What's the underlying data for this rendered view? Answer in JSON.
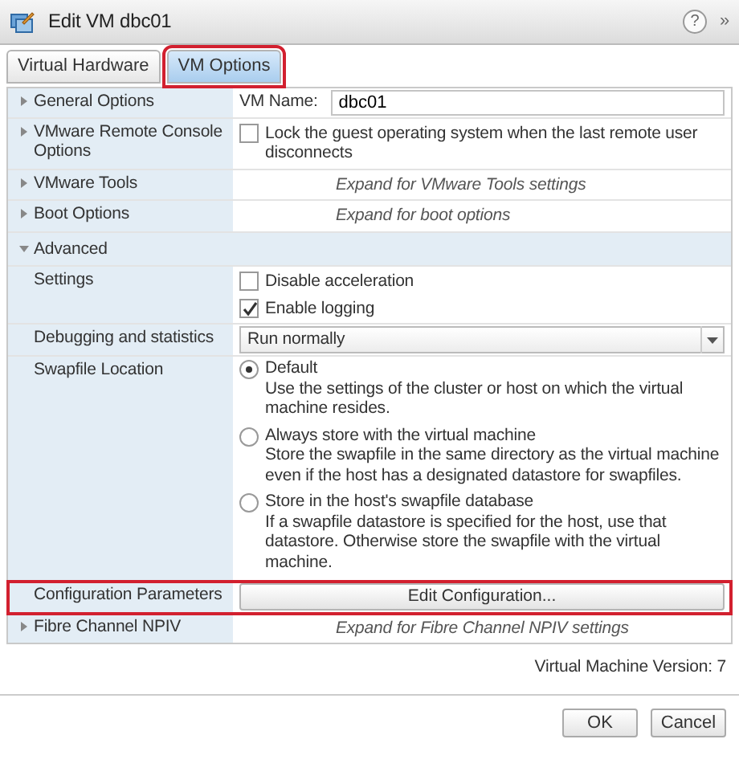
{
  "window": {
    "title": "Edit VM dbc01",
    "help": "?",
    "expand": "»"
  },
  "tabs": [
    {
      "label": "Virtual Hardware",
      "selected": false,
      "highlighted": false
    },
    {
      "label": "VM Options",
      "selected": true,
      "highlighted": true
    }
  ],
  "sections": [
    {
      "kind": "field",
      "label": "General Options",
      "expanded": false,
      "field_label": "VM Name:",
      "value": "dbc01"
    },
    {
      "kind": "checkbox",
      "label": "VMware Remote Console Options",
      "expanded": false,
      "options": [
        {
          "label": "Lock the guest operating system when the last remote user disconnects",
          "checked": false
        }
      ]
    },
    {
      "kind": "hint",
      "label": "VMware Tools",
      "expanded": false,
      "hint": "Expand for VMware Tools settings"
    },
    {
      "kind": "hint",
      "label": "Boot Options",
      "expanded": false,
      "hint": "Expand for boot options"
    },
    {
      "kind": "group",
      "label": "Advanced",
      "expanded": true,
      "children": [
        {
          "kind": "checkbox",
          "label": "Settings",
          "options": [
            {
              "label": "Disable acceleration",
              "checked": false
            },
            {
              "label": "Enable logging",
              "checked": true
            }
          ]
        },
        {
          "kind": "select",
          "label": "Debugging and statistics",
          "value": "Run normally"
        },
        {
          "kind": "radio",
          "label": "Swapfile Location",
          "options": [
            {
              "label": "Default",
              "description": "Use the settings of the cluster or host on which the virtual machine resides.",
              "selected": true
            },
            {
              "label": "Always store with the virtual machine",
              "description": "Store the swapfile in the same directory as the virtual machine even if the host has a designated datastore for swapfiles.",
              "selected": false
            },
            {
              "label": "Store in the host's swapfile database",
              "description": "If a swapfile datastore is specified for the host, use that datastore. Otherwise store the swapfile with the virtual machine.",
              "selected": false
            }
          ]
        },
        {
          "kind": "button",
          "label": "Configuration Parameters",
          "button": "Edit Configuration...",
          "highlighted": true
        }
      ]
    },
    {
      "kind": "hint",
      "label": "Fibre Channel NPIV",
      "expanded": false,
      "hint": "Expand for Fibre Channel NPIV settings"
    }
  ],
  "version": "Virtual Machine Version: 7",
  "buttons": [
    "OK",
    "Cancel"
  ]
}
